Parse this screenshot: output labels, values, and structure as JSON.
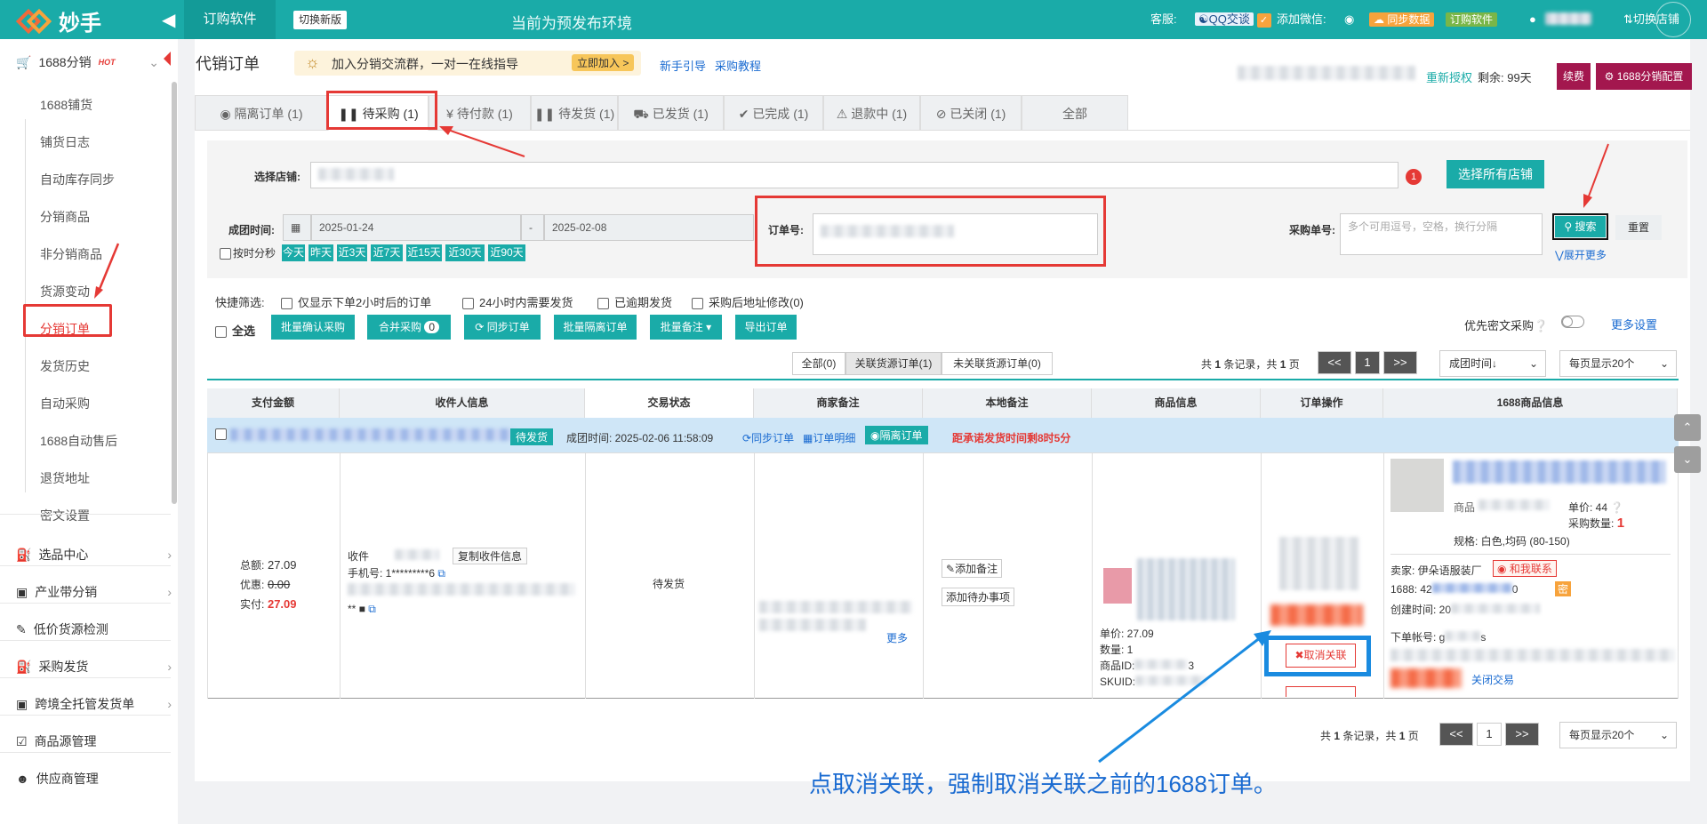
{
  "top": {
    "logo": "妙手",
    "app": "订购软件",
    "switch": "切换新版",
    "env": "当前为预发布环境",
    "service": "客服:",
    "qq": "QQ交谈",
    "wechat": "添加微信:",
    "sync": "同步数据",
    "order_soft": "订购软件",
    "switch_shop": "切换店铺"
  },
  "sidebar": {
    "head": "1688分销",
    "hot": "HOT",
    "subs": [
      "1688铺货",
      "铺货日志",
      "自动库存同步",
      "分销商品",
      "非分销商品",
      "货源变动",
      "分销订单",
      "发货历史",
      "自动采购",
      "1688自动售后",
      "退货地址",
      "密文设置"
    ],
    "menu": [
      "选品中心",
      "产业带分销",
      "低价货源检测",
      "采购发货",
      "跨境全托管发货单",
      "商品源管理",
      "供应商管理"
    ]
  },
  "main": {
    "title": "代销订单",
    "banner": "加入分销交流群，一对一在线指导",
    "join": "立即加入 >",
    "guide": "新手引导",
    "tutorial": "采购教程",
    "reauth": "重新授权",
    "remain": "剩余: 99天",
    "renew": "续费",
    "config": "1688分销配置",
    "tabs": [
      "隔离订单 (1)",
      "待采购 (1)",
      "待付款 (1)",
      "待发货 (1)",
      "已发货 (1)",
      "已完成 (1)",
      "退款中 (1)",
      "已关闭 (1)",
      "全部"
    ],
    "filter": {
      "shop_label": "选择店铺:",
      "badge": "1",
      "select_all": "选择所有店铺",
      "time_label": "成团时间:",
      "date_from": "2025-01-24",
      "date_sep": "-",
      "date_to": "2025-02-08",
      "precise": "按时分秒",
      "quick": [
        "今天",
        "昨天",
        "近3天",
        "近7天",
        "近15天",
        "近30天",
        "近90天"
      ],
      "order_label": "订单号:",
      "purchase_label": "采购单号:",
      "purchase_ph": "多个可用逗号，空格，换行分隔",
      "search": "搜索",
      "reset": "重置",
      "more": "展开更多"
    },
    "quick_filter": {
      "label": "快捷筛选:",
      "opts": [
        "仅显示下单2小时后的订单",
        "24小时内需要发货",
        "已逾期发货",
        "采购后地址修改(0)"
      ]
    },
    "actions": {
      "select_all": "全选",
      "confirm": "批量确认采购",
      "merge": "合并采购",
      "merge_count": "0",
      "sync": "同步订单",
      "isolate": "批量隔离订单",
      "remark": "批量备注",
      "export": "导出订单",
      "secret": "优先密文采购",
      "more_settings": "更多设置"
    },
    "segments": [
      "全部(0)",
      "关联货源订单(1)",
      "未关联货源订单(0)"
    ],
    "pager": {
      "info_a": "共 ",
      "count": "1",
      "info_b": " 条记录，共 ",
      "pages": "1",
      "info_c": " 页",
      "prev": "<<",
      "page": "1",
      "next": ">>",
      "sort": "成团时间↓",
      "per_page": "每页显示20个"
    },
    "columns": [
      "支付金额",
      "收件人信息",
      "交易状态",
      "商家备注",
      "本地备注",
      "商品信息",
      "订单操作",
      "1688商品信息"
    ],
    "row_head": {
      "status": "待发货",
      "time": "成团时间: 2025-02-06 11:58:09",
      "sync": "同步订单",
      "detail": "订单明细",
      "isolate": "隔离订单",
      "deadline": "距承诺发货时间剩8时5分"
    },
    "row": {
      "total_l": "总额:",
      "total": "27.09",
      "disc_l": "优惠:",
      "disc": "0.00",
      "paid_l": "实付:",
      "paid": "27.09",
      "recv": "收件",
      "copy": "复制收件信息",
      "phone": "手机号: 1*********6",
      "stars": "**",
      "state": "待发货",
      "more": "更多",
      "add_remark": "添加备注",
      "add_todo": "添加待办事项",
      "price": "单价: 27.09",
      "qty": "数量: 1",
      "pid": "商品ID:",
      "pid_tail": "3",
      "sku": "SKUID:",
      "cancel": "取消关联",
      "unit_price": "单价: 44",
      "buy_qty_l": "采购数量:",
      "buy_qty": "1",
      "spec": "规格: 白色,均码 (80-150)",
      "seller": "卖家: 伊朵语服装厂",
      "contact": "和我联系",
      "p1688": "1688: 42",
      "p1688_tail": "0",
      "mi": "密",
      "created": "创建时间: 20",
      "account": "下单帐号: g",
      "account_tail": "s",
      "close_trade": "关闭交易",
      "goods_label": "商品"
    },
    "annotation": "点取消关联，强制取消关联之前的1688订单。"
  }
}
